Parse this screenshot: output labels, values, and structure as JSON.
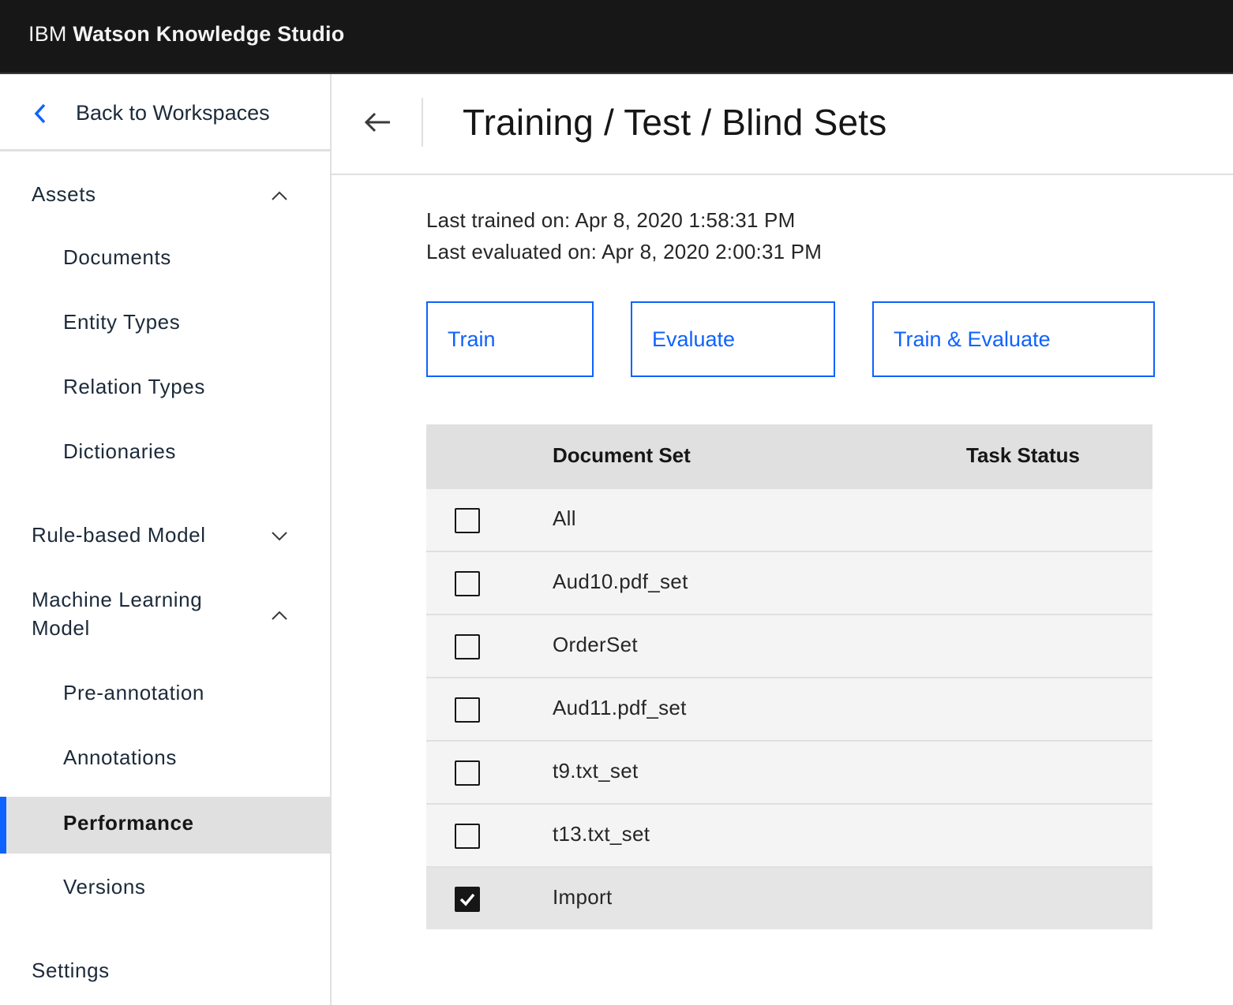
{
  "app": {
    "brand_prefix": "IBM",
    "brand_name": "Watson Knowledge Studio"
  },
  "sidebar": {
    "back_label": "Back to Workspaces",
    "sections": [
      {
        "label": "Assets",
        "expanded": true,
        "items": [
          "Documents",
          "Entity Types",
          "Relation Types",
          "Dictionaries"
        ]
      },
      {
        "label": "Rule-based Model",
        "expanded": false,
        "items": []
      },
      {
        "label_line1": "Machine Learning",
        "label_line2": "Model",
        "expanded": true,
        "items": [
          "Pre-annotation",
          "Annotations",
          "Performance",
          "Versions"
        ]
      },
      {
        "label": "Settings"
      }
    ],
    "active_item": "Performance",
    "accent_color": "#0f62fe"
  },
  "main": {
    "title": "Training / Test / Blind Sets",
    "last_trained": "Last trained on: Apr 8, 2020 1:58:31 PM",
    "last_evaluated": "Last evaluated on: Apr 8, 2020 2:00:31 PM",
    "buttons": {
      "train": "Train",
      "evaluate": "Evaluate",
      "train_evaluate": "Train & Evaluate"
    },
    "table": {
      "columns": [
        "Document Set",
        "Task Status"
      ],
      "rows": [
        {
          "name": "All",
          "status": "",
          "checked": false
        },
        {
          "name": "Aud10.pdf_set",
          "status": "",
          "checked": false
        },
        {
          "name": "OrderSet",
          "status": "",
          "checked": false
        },
        {
          "name": "Aud11.pdf_set",
          "status": "",
          "checked": false
        },
        {
          "name": "t9.txt_set",
          "status": "",
          "checked": false
        },
        {
          "name": "t13.txt_set",
          "status": "",
          "checked": false
        },
        {
          "name": "Import",
          "status": "",
          "checked": true
        }
      ]
    }
  }
}
